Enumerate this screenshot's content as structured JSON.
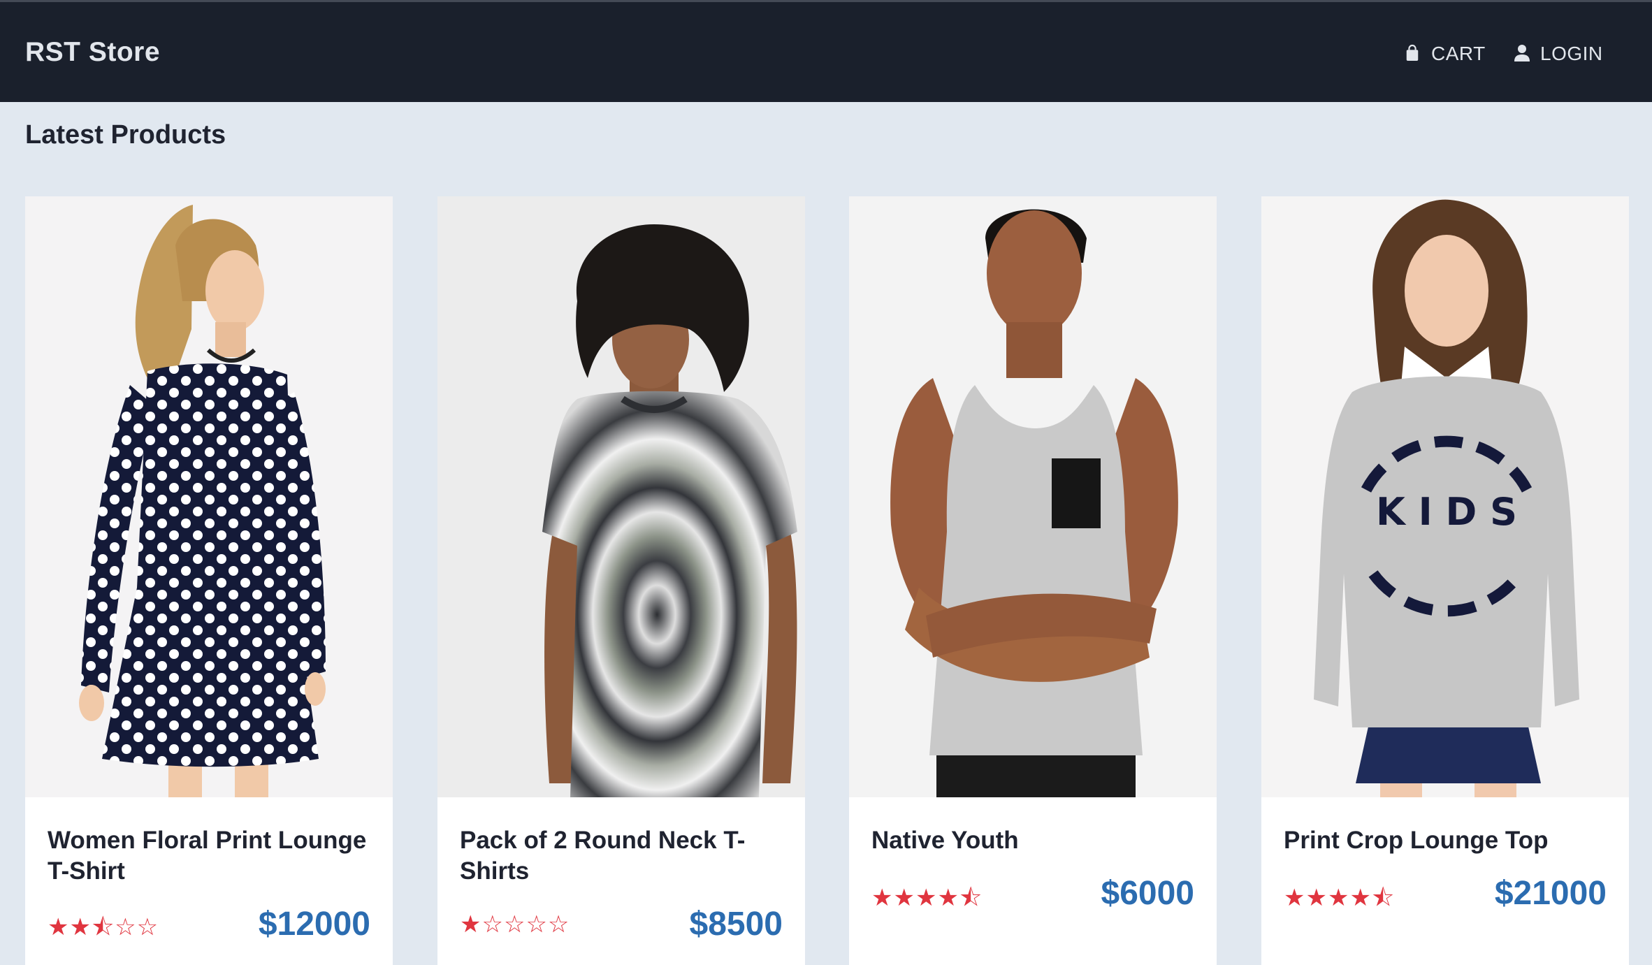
{
  "header": {
    "brand": "RST Store",
    "cart_label": "CART",
    "login_label": "LOGIN",
    "cart_icon": "shopping-bag-icon",
    "login_icon": "user-icon"
  },
  "main": {
    "section_title": "Latest Products",
    "products": [
      {
        "title": "Women Floral Print Lounge T-Shirt",
        "rating_stars": "★★⯪☆☆",
        "rating": 2.5,
        "price": "$12000",
        "image": "model-polka-dot-dress"
      },
      {
        "title": "Pack of 2 Round Neck T-Shirts",
        "rating_stars": "★☆☆☆☆",
        "rating": 1,
        "price": "$8500",
        "image": "model-tie-dye-tshirt"
      },
      {
        "title": "Native Youth",
        "rating_stars": "★★★★⯪",
        "rating": 4.5,
        "price": "$6000",
        "image": "model-grey-tank-top"
      },
      {
        "title": "Print Crop Lounge Top",
        "rating_stars": "★★★★⯪",
        "rating": 4.5,
        "price": "$21000",
        "image": "model-cool-kids-club-sweatshirt"
      }
    ]
  },
  "colors": {
    "navbar": "#1a202c",
    "background": "#e1e8f0",
    "star": "#e0353f",
    "price": "#2b6cb0"
  }
}
